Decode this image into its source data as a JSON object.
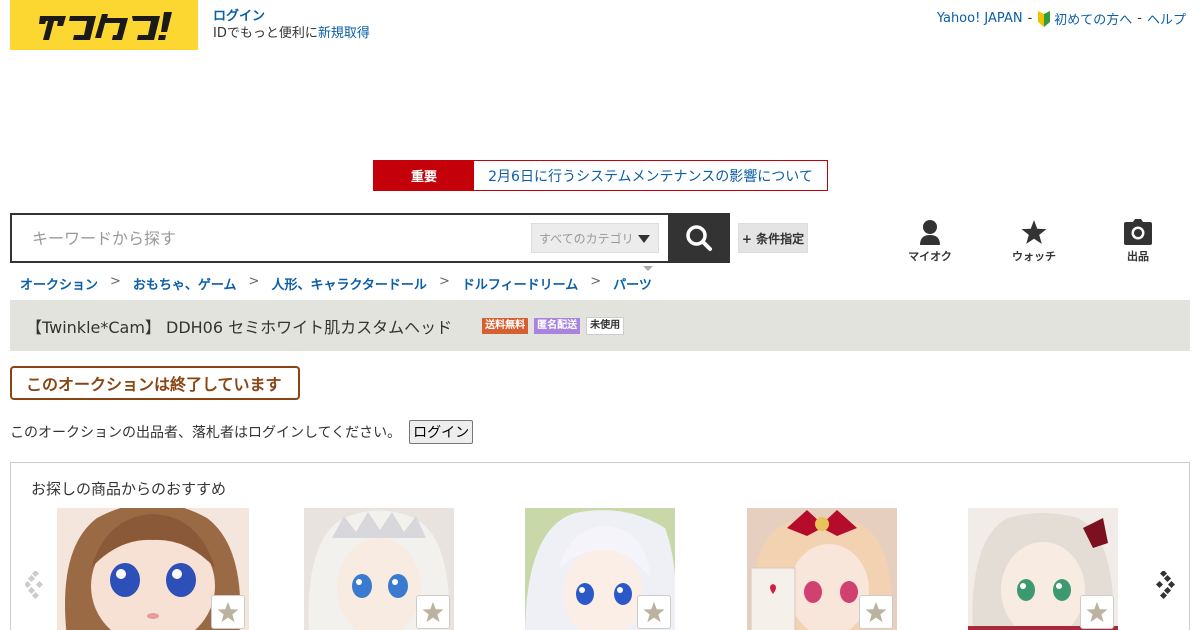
{
  "header": {
    "logo_text": "ヤフオク!",
    "login_label": "ログイン",
    "login_sub_prefix": "IDでもっと便利に",
    "register_label": "新規取得",
    "links": {
      "yahoo_japan": "Yahoo! JAPAN",
      "beginner": "初めての方へ",
      "help": "ヘルプ"
    }
  },
  "notice": {
    "tag": "重要",
    "text": "2月6日に行うシステムメンテナンスの影響について"
  },
  "search": {
    "placeholder": "キーワードから探す",
    "category_label": "すべてのカテゴリ",
    "condition_button": "+ 条件指定"
  },
  "nav": {
    "myauction": "マイオク",
    "watch": "ウォッチ",
    "sell": "出品"
  },
  "breadcrumb": [
    "オークション",
    "おもちゃ、ゲーム",
    "人形、キャラクタードール",
    "ドルフィードリーム",
    "パーツ"
  ],
  "breadcrumb_separator": ">",
  "item": {
    "title": "【Twinkle*Cam】 DDH06 セミホワイト肌カスタムヘッド",
    "badges": {
      "free_shipping": "送料無料",
      "anonymous": "匿名配送",
      "unused": "未使用"
    }
  },
  "status": {
    "ended": "このオークションは終了しています",
    "login_note": "このオークションの出品者、落札者はログインしてください。",
    "login_button": "ログイン"
  },
  "recommend": {
    "heading": "お探しの商品からのおすすめ"
  },
  "colors": {
    "brand_yellow": "#fcd731",
    "notice_red": "#c4000b",
    "link_blue": "#0b5ea8",
    "ended_brown": "#8b4513"
  }
}
